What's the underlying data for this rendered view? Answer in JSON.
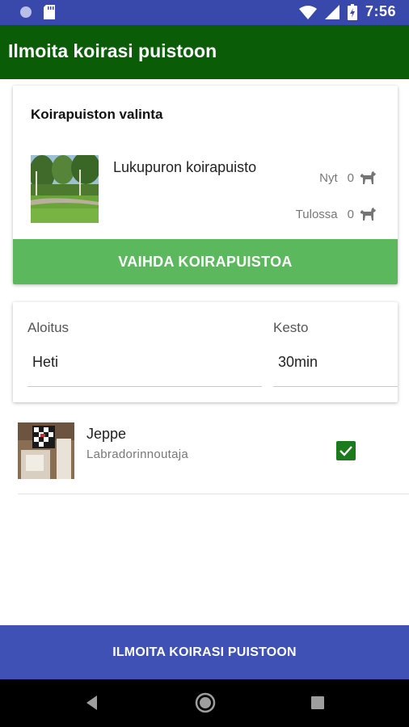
{
  "status_bar": {
    "time": "7:56",
    "icons": [
      "circle-dot-icon",
      "sd-card-icon",
      "wifi-icon",
      "signal-icon",
      "battery-charging-icon"
    ]
  },
  "app_bar": {
    "title": "Ilmoita koirasi puistoon",
    "color": "#0a5c07"
  },
  "park_card": {
    "heading": "Koirapuiston valinta",
    "park_name": "Lukupuron koirapuisto",
    "stats": [
      {
        "label": "Nyt",
        "count": "0",
        "icon": "dog-icon"
      },
      {
        "label": "Tulossa",
        "count": "0",
        "icon": "dog-icon"
      }
    ],
    "change_button_label": "VAIHDA KOIRAPUISTOA",
    "change_button_color": "#5cb85c"
  },
  "time_card": {
    "start": {
      "label": "Aloitus",
      "value": "Heti"
    },
    "duration": {
      "label": "Kesto",
      "value": "30min"
    }
  },
  "dogs": [
    {
      "name": "Jeppe",
      "breed": "Labradorinnoutaja",
      "selected": true
    }
  ],
  "submit_button": {
    "label": "ILMOITA KOIRASI PUISTOON",
    "color": "#3f51b5"
  },
  "nav_bar": {
    "buttons": [
      "back-icon",
      "home-icon",
      "recents-icon"
    ]
  }
}
